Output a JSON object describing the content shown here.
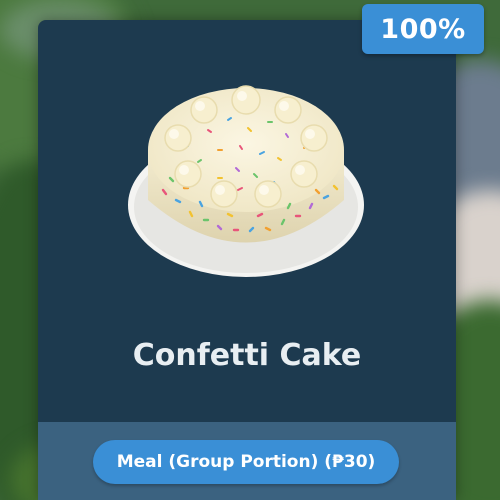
{
  "completion_badge": {
    "text": "100%"
  },
  "item": {
    "name": "Confetti Cake",
    "image_icon": "confetti-cake-icon",
    "category_tag": "Meal (Group Portion) (₱30)"
  },
  "colors": {
    "card": "#1d3a4f",
    "card_footer": "#3b6280",
    "accent": "#3a8fd6",
    "title_text": "#e8eef2"
  }
}
